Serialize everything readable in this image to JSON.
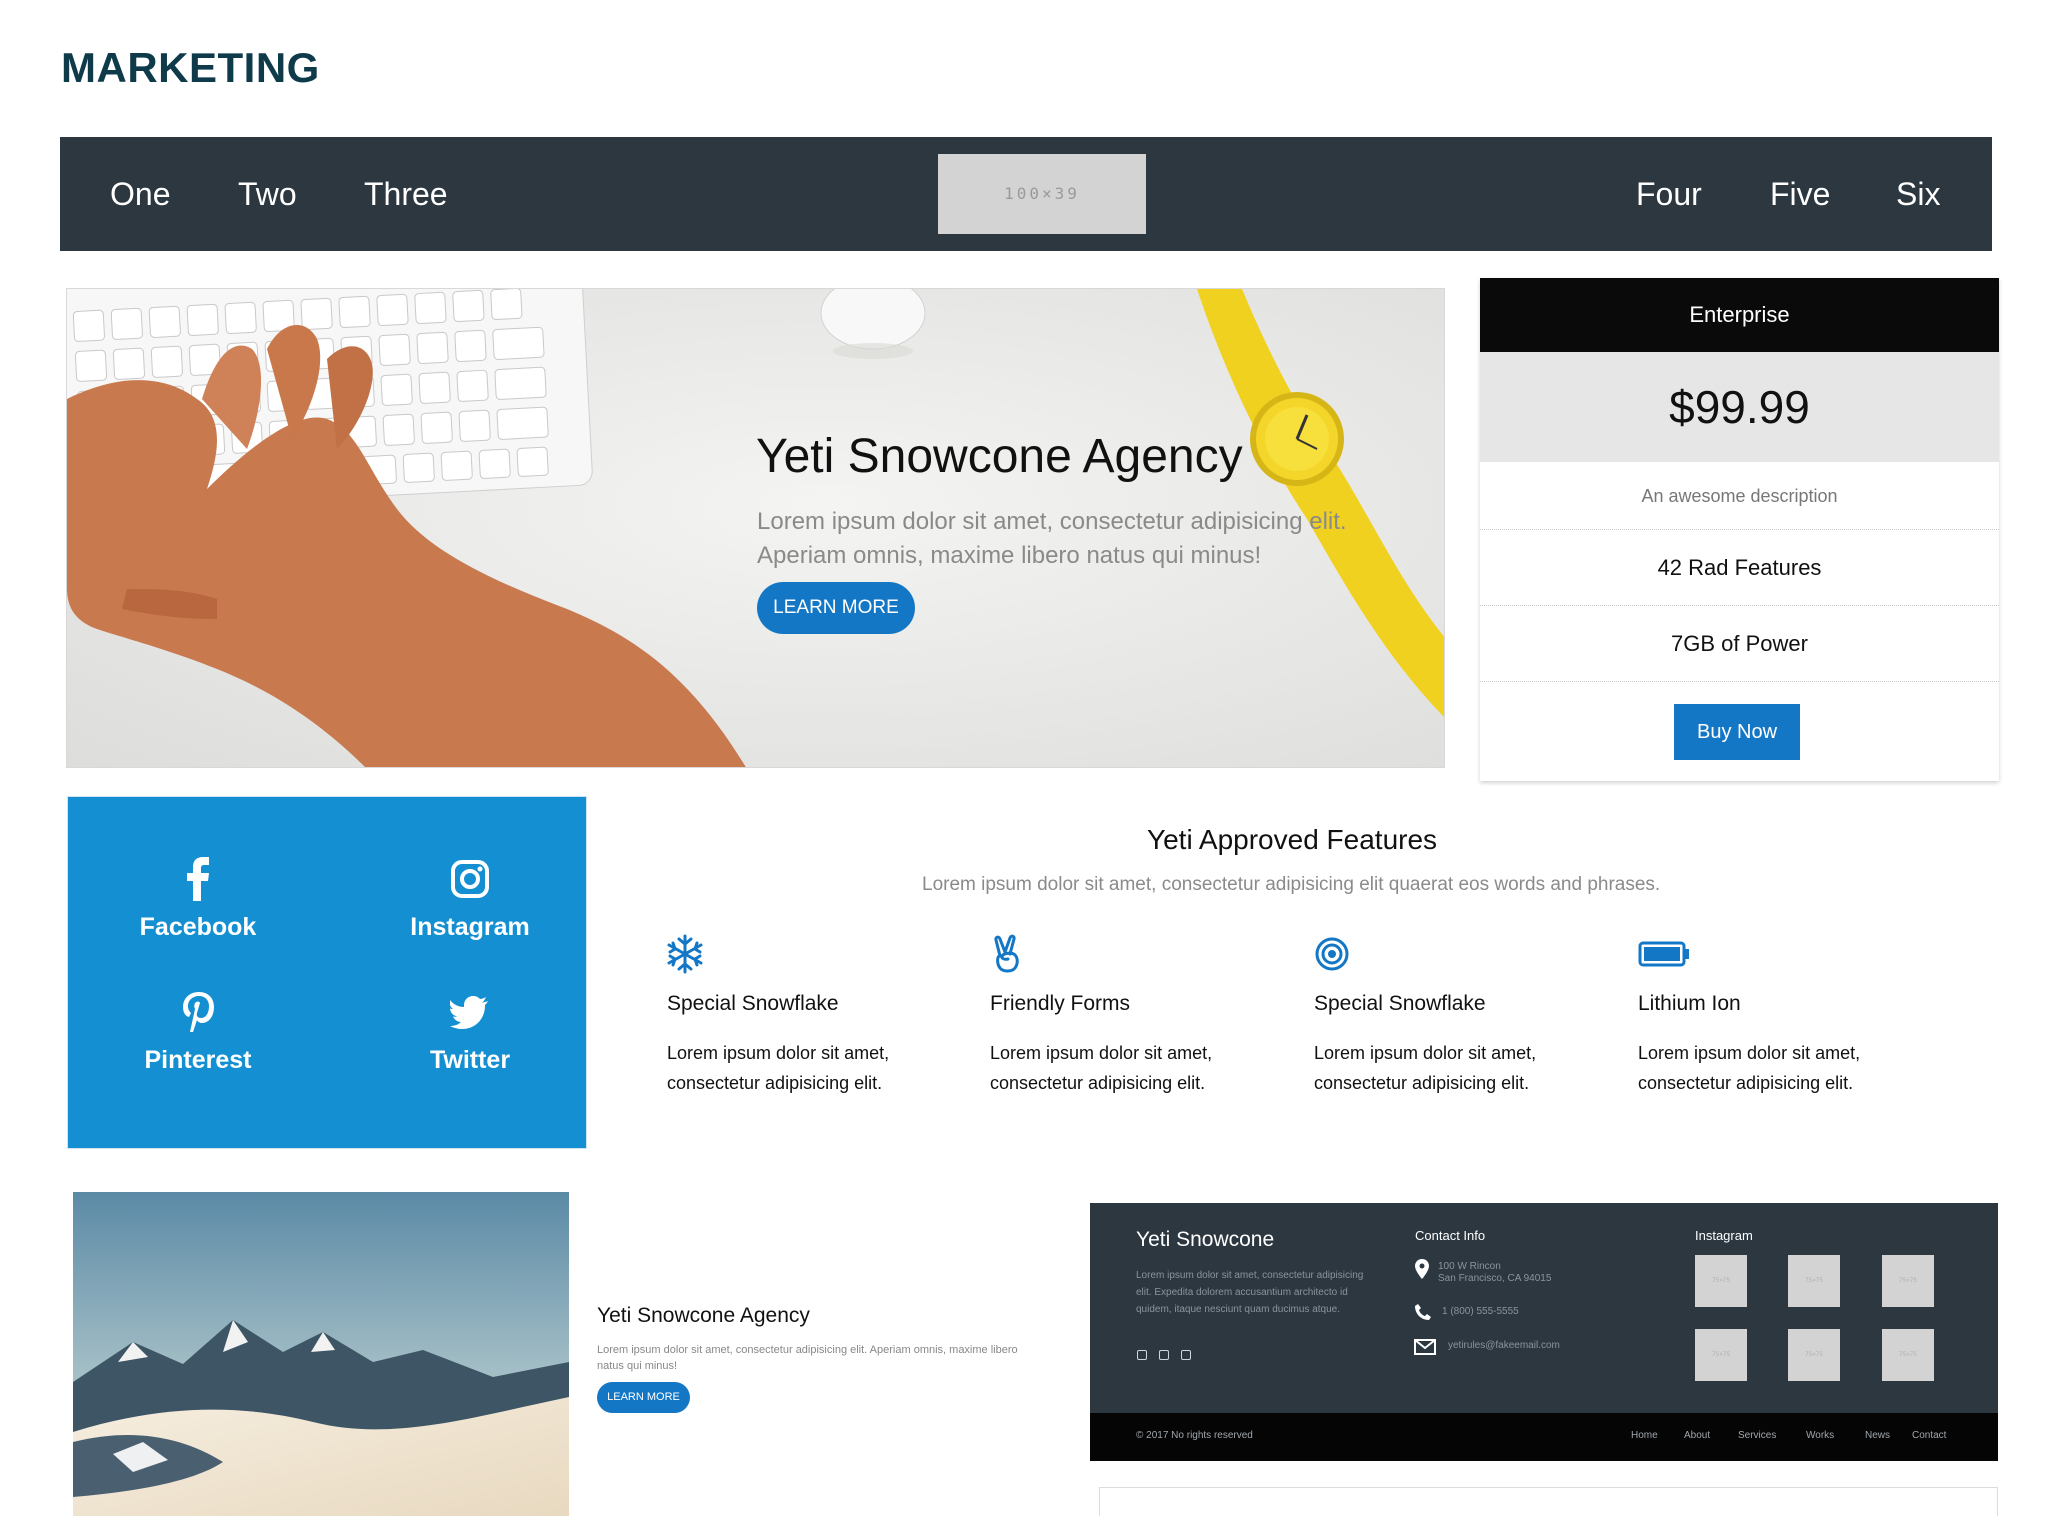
{
  "page": {
    "title": "MARKETING"
  },
  "topnav": {
    "left_items": [
      "One",
      "Two",
      "Three"
    ],
    "logo_placeholder": "100×39",
    "right_items": [
      "Four",
      "Five",
      "Six"
    ]
  },
  "hero": {
    "title": "Yeti Snowcone Agency",
    "text": "Lorem ipsum dolor sit amet, consectetur adipisicing elit. Aperiam omnis, maxime libero natus qui minus!",
    "button": "LEARN MORE"
  },
  "pricing": {
    "plan": "Enterprise",
    "price": "$99.99",
    "description": "An awesome description",
    "features": [
      "42 Rad Features",
      "7GB of Power"
    ],
    "button": "Buy Now"
  },
  "social": {
    "items": [
      {
        "label": "Facebook",
        "icon": "facebook-icon"
      },
      {
        "label": "Instagram",
        "icon": "instagram-icon"
      },
      {
        "label": "Pinterest",
        "icon": "pinterest-icon"
      },
      {
        "label": "Twitter",
        "icon": "twitter-icon"
      }
    ]
  },
  "features": {
    "title": "Yeti Approved Features",
    "subtitle": "Lorem ipsum dolor sit amet, consectetur adipisicing elit quaerat eos words and phrases.",
    "items": [
      {
        "icon": "snowflake-icon",
        "name": "Special Snowflake",
        "text": "Lorem ipsum dolor sit amet, consectetur adipisicing elit."
      },
      {
        "icon": "peace-hand-icon",
        "name": "Friendly Forms",
        "text": "Lorem ipsum dolor sit amet, consectetur adipisicing elit."
      },
      {
        "icon": "target-icon",
        "name": "Special Snowflake",
        "text": "Lorem ipsum dolor sit amet, consectetur adipisicing elit."
      },
      {
        "icon": "battery-icon",
        "name": "Lithium Ion",
        "text": "Lorem ipsum dolor sit amet, consectetur adipisicing elit."
      }
    ]
  },
  "card": {
    "title": "Yeti Snowcone Agency",
    "text": "Lorem ipsum dolor sit amet, consectetur adipisicing elit. Aperiam omnis, maxime libero natus qui minus!",
    "button": "LEARN MORE"
  },
  "footer": {
    "brand": "Yeti Snowcone",
    "about": "Lorem ipsum dolor sit amet, consectetur adipisicing elit. Expedita dolorem accusantium architecto id quidem, itaque nesciunt quam ducimus atque.",
    "contact_heading": "Contact Info",
    "address_line1": "100 W Rincon",
    "address_line2": "San Francisco, CA 94015",
    "phone": "1 (800) 555-5555",
    "email": "yetirules@fakeemail.com",
    "instagram_heading": "Instagram",
    "thumb_placeholder": "75×75",
    "copyright": "© 2017 No rights reserved",
    "links": [
      "Home",
      "About",
      "Services",
      "Works",
      "News",
      "Contact"
    ]
  },
  "colors": {
    "nav_bg": "#2c3740",
    "accent": "#1477c5",
    "social_bg": "#1490d2",
    "title": "#0f3a4a",
    "pricing_head": "#0a0a0a"
  }
}
